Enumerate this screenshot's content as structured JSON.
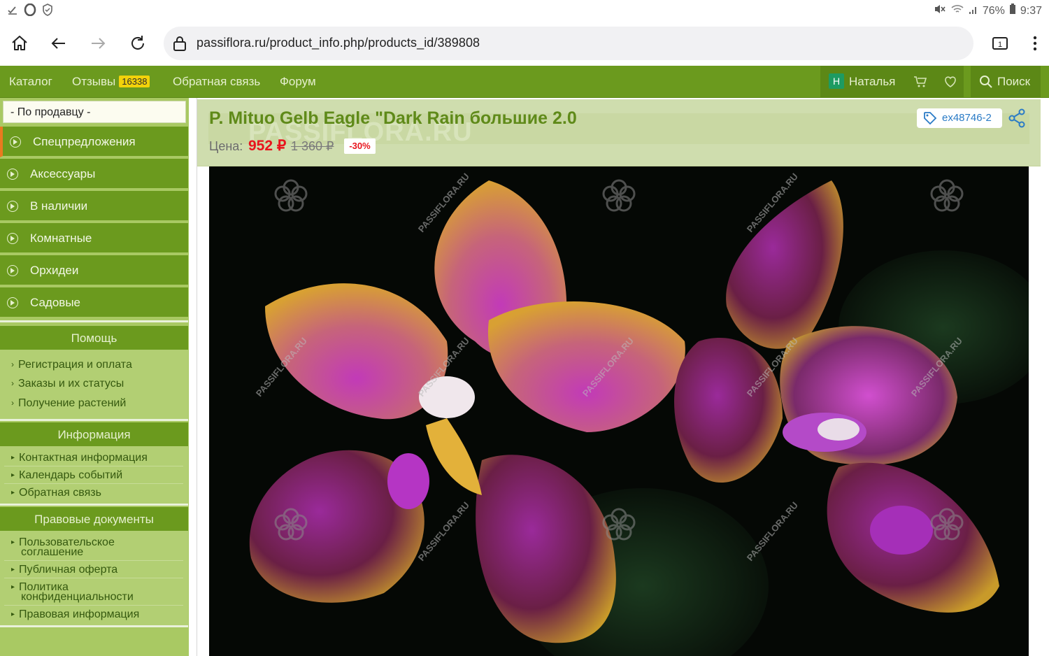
{
  "statusbar": {
    "left_icons": [
      "download-done-icon",
      "opera-icon",
      "shield-icon"
    ],
    "battery": "76%",
    "time": "9:37"
  },
  "browser": {
    "url": "passiflora.ru/product_info.php/products_id/389808",
    "tabs_count": "1"
  },
  "nav": {
    "catalog": "Каталог",
    "reviews": "Отзывы",
    "reviews_count": "16338",
    "feedback": "Обратная связь",
    "forum": "Форум",
    "user_initial": "Н",
    "user_name": "Наталья",
    "search": "Поиск"
  },
  "sidebar": {
    "seller_select": "- По продавцу -",
    "categories": [
      {
        "label": "Спецпредложения"
      },
      {
        "label": "Аксессуары"
      },
      {
        "label": "В наличии"
      },
      {
        "label": "Комнатные"
      },
      {
        "label": "Орхидеи"
      },
      {
        "label": "Садовые"
      }
    ],
    "help": {
      "title": "Помощь",
      "links": [
        "Регистрация и оплата",
        "Заказы и их статусы",
        "Получение растений"
      ]
    },
    "info": {
      "title": "Информация",
      "links": [
        "Контактная информация",
        "Календарь событий",
        "Обратная связь"
      ]
    },
    "legal": {
      "title": "Правовые документы",
      "links": [
        {
          "line1": "Пользовательское",
          "line2": "соглашение"
        },
        {
          "line1": "Публичная оферта",
          "line2": ""
        },
        {
          "line1": "Политика",
          "line2": "конфиденциальности"
        },
        {
          "line1": "Правовая информация",
          "line2": ""
        }
      ]
    }
  },
  "product": {
    "title": "P. Mituo Gelb Eagle \"Dark Rain большие 2.0",
    "watermark": "PASSIFLORA.RU",
    "price_label": "Цена:",
    "price": "952 ₽",
    "old_price": "1 360 ₽",
    "discount": "-30%",
    "sku": "ex48746-2",
    "photo_watermark": "PASSIFLORA.RU"
  }
}
